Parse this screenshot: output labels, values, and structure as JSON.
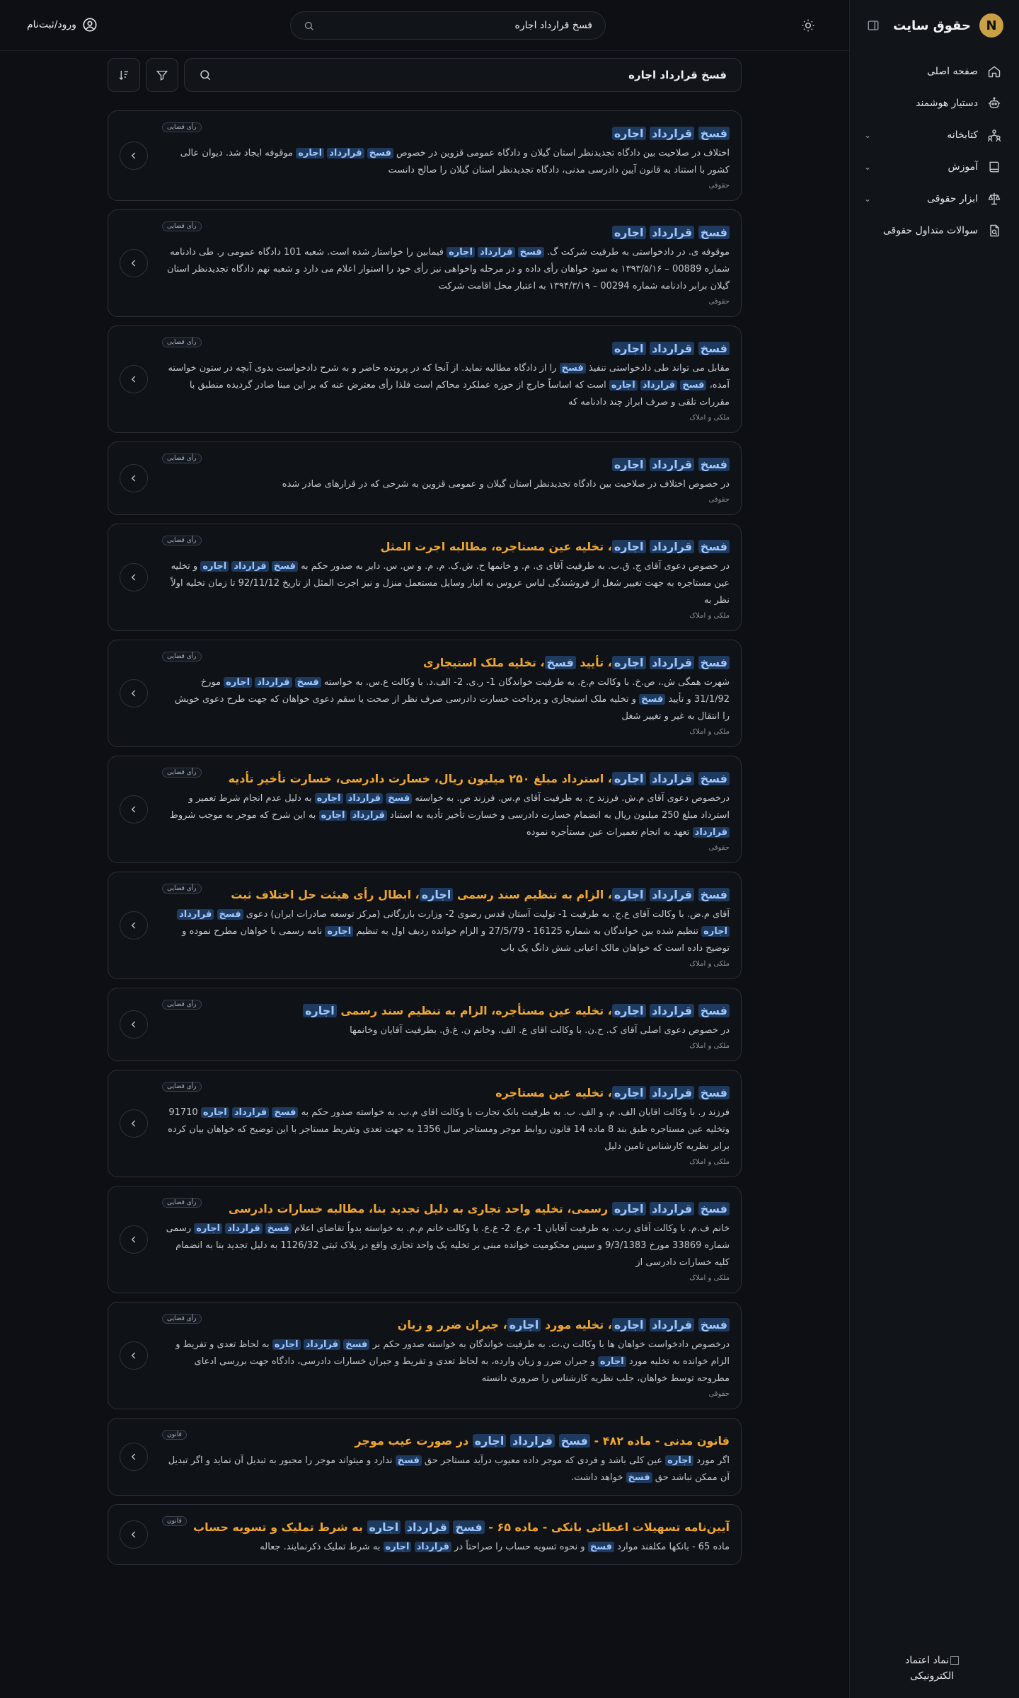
{
  "brand": {
    "logo_letter": "N",
    "name": "حقوق سایت",
    "accent": "#caa046"
  },
  "sidebar": {
    "items": [
      {
        "label": "صفحه اصلی",
        "icon": "home-icon",
        "expandable": false
      },
      {
        "label": "دستیار هوشمند",
        "icon": "robot-icon",
        "expandable": false
      },
      {
        "label": "کتابخانه",
        "icon": "library-icon",
        "expandable": true
      },
      {
        "label": "آموزش",
        "icon": "book-icon",
        "expandable": true
      },
      {
        "label": "ابزار حقوقی",
        "icon": "scale-icon",
        "expandable": true
      },
      {
        "label": "سوالات متداول حقوقی",
        "icon": "faq-document-icon",
        "expandable": false
      }
    ],
    "trust_logo_alt": "نماد اعتماد الکترونیکی"
  },
  "topbar": {
    "search_value": "فسخ قرارداد اجاره",
    "login_label": "ورود/ثبت‌نام"
  },
  "main": {
    "search_value": "فسخ قرارداد اجاره"
  },
  "colors": {
    "title": "#f0a62d",
    "highlight_bg": "#1e3a5f",
    "highlight_text": "#9fc7ff",
    "background": "#0d0f14"
  },
  "results": [
    {
      "badge": "رأی قضایی",
      "title": "<mark>فسخ</mark> <mark>قرارداد</mark> <mark>اجاره</mark>",
      "snippet": "اختلاف در صلاحیت بین دادگاه تجدیدنظر استان گیلان و دادگاه عمومی قزوین در خصوص <mark>فسخ</mark> <mark>قرارداد</mark> <mark>اجاره</mark> موقوفه ایجاد شد. دیوان عالی کشور با استناد به قانون آیین دادرسی مدنی، دادگاه تجدیدنظر استان گیلان را صالح دانست",
      "category": "حقوقی"
    },
    {
      "badge": "رأی قضایی",
      "title": "<mark>فسخ</mark> <mark>قرارداد</mark> <mark>اجاره</mark>",
      "snippet": "موقوفه ی. در دادخواستی به طرفیت شرکت گ. <mark>فسخ</mark> <mark>قرارداد</mark> <mark>اجاره</mark> فیمابین را خواستار شده است. شعبه 101 دادگاه عمومی ر. طی دادنامه شماره 00889 – ۱۳۹۳/۵/۱۶ به سود خواهان رأی داده و در مرحله واخواهی نیز رأی خود را استوار اعلام می دارد و شعبه نهم دادگاه تجدیدنظر استان گیلان برابر دادنامه شماره 00294 – ۱۳۹۴/۳/۱۹ به اعتبار محل اقامت شرکت",
      "category": "حقوقی"
    },
    {
      "badge": "رأی قضایی",
      "title": "<mark>فسخ</mark> <mark>قرارداد</mark> <mark>اجاره</mark>",
      "snippet": "مقابل می تواند طی دادخواستی تنفیذ <mark>فسخ</mark> را از دادگاه مطالبه نماید. از آنجا که در پرونده حاضر و به شرح دادخواست بدوی آنچه در ستون خواسته آمده، <mark>فسخ</mark> <mark>قرارداد</mark> <mark>اجاره</mark> است که اساساً خارج از حوزه عملکرد محاکم است فلذا رأی معترض عنه که بر این مبنا صادر گردیده منطبق با مقررات تلقی و صرف ابراز چند دادنامه که",
      "category": "ملکی و املاک"
    },
    {
      "badge": "رأی قضایی",
      "title": "<mark>فسخ</mark> <mark>قرارداد</mark> <mark>اجاره</mark>",
      "snippet": "در خصوص اختلاف در صلاحیت بین دادگاه تجدیدنظر استان گیلان و عمومی قزوین به شرحی که در قرارهای صادر شده",
      "category": "حقوقی"
    },
    {
      "badge": "رأی قضایی",
      "title": "<mark>فسخ</mark> <mark>قرارداد</mark> <mark>اجاره</mark>، تخلیه عین مستاجره، مطالبه اجرت المثل",
      "snippet": "در خصوص دعوی آقای ج. ق.ب. به طرفیت آقای ی. م. و خانمها ح. ش.ک. م. م. و س. س. دایر به صدور حکم به <mark>فسخ</mark> <mark>قرارداد</mark> <mark>اجاره</mark> و تخلیه عین مستاجره به جهت تغییر شغل از فروشندگی لباس عروس به انبار وسایل مستعمل منزل و نیز اجرت المثل از تاریخ 92/11/12 تا زمان تخلیه اولاً نظر به",
      "category": "ملکی و املاک"
    },
    {
      "badge": "رأی قضایی",
      "title": "<mark>فسخ</mark> <mark>قرارداد</mark> <mark>اجاره</mark>، تأیید <mark>فسخ</mark>، تخلیه ملک استیجاری",
      "snippet": "شهرت همگی ش.، ص.خ. با وکالت م.ع. به طرفیت خواندگان 1- ر.ی. 2- الف.د. با وکالت ع.س. به خواسته <mark>فسخ</mark> <mark>قرارداد</mark> <mark>اجاره</mark> مورخ 31/1/92 و تأیید <mark>فسخ</mark> و تخلیه ملک استیجاری و پرداخت خسارت دادرسی صرف نظر از صحت یا سقم دعوی خواهان که جهت طرح دعوی خویش را انتقال به غیر و تغییر شغل",
      "category": "ملکی و املاک"
    },
    {
      "badge": "رأی قضایی",
      "title": "<mark>فسخ</mark> <mark>قرارداد</mark> <mark>اجاره</mark>، استرداد مبلغ ۲۵۰ میلیون ریال، خسارت دادرسی، خسارت تأخیر تأدیه",
      "snippet": "درخصوص دعوی آقای م.ش. فرزند ح. به طرفیت آقای م.س. فرزند ص. به خواسته <mark>فسخ</mark> <mark>قرارداد</mark> <mark>اجاره</mark> به دلیل عدم انجام شرط تعمیر و استرداد مبلغ 250 میلیون ریال به انضمام خسارت دادرسی و خسارت تأخیر تأدیه به استناد <mark>قرارداد</mark> <mark>اجاره</mark> به این شرح که موجر به موجب شروط <mark>قرارداد</mark> تعهد به انجام تعمیرات عین مستأجره نموده",
      "category": "حقوقی"
    },
    {
      "badge": "رأی قضایی",
      "title": "<mark>فسخ</mark> <mark>قرارداد</mark> <mark>اجاره</mark>، الزام به تنظیم سند رسمی <mark>اجاره</mark>، ابطال رأی هیئت حل اختلاف ثبت",
      "snippet": "آقای م.ض. با وکالت آقای ع.ج. به طرفیت 1- تولیت آستان قدس رضوی 2- وزارت بازرگانی (مرکز توسعه صادرات ایران) دعوی <mark>فسخ</mark> <mark>قرارداد</mark> <mark>اجاره</mark> تنظیم شده بین خواندگان به شماره 16125 - 27/5/79 و الزام خوانده ردیف اول به تنظیم <mark>اجاره</mark> نامه رسمی با خواهان مطرح نموده و توضیح داده است که خواهان مالک اعیانی شش دانگ یک باب",
      "category": "ملکی و املاک"
    },
    {
      "badge": "رأی قضایی",
      "title": "<mark>فسخ</mark> <mark>قرارداد</mark> <mark>اجاره</mark>، تخلیه عین مستأجره، الزام به تنظیم سند رسمی <mark>اجاره</mark>",
      "snippet": "در خصوص دعوی اصلی آقای ک. ح.ن. با وکالت اقای ع. الف. وخانم ن. غ.ق. بطرفیت آقایان وخانمها",
      "category": "ملکی و املاک"
    },
    {
      "badge": "رأی قضایی",
      "title": "<mark>فسخ</mark> <mark>قرارداد</mark> <mark>اجاره</mark>، تخلیه عین مستاجره",
      "snippet": "فرزند ر. با وکالت اقایان الف. م. و الف. ب. به طرفیت بانک تجارت با وکالت اقای م.ب. به خواسته صدور حکم به <mark>فسخ</mark> <mark>قرارداد</mark> <mark>اجاره</mark> 91710 وتخلیه عین مستاجره طبق بند 8 ماده 14 قانون روابط موجر ومستاجر سال 1356 به جهت تعدی وتفریط مستاجر با این توضیح که خواهان بیان کرده برابر نظریه کارشناس تامین دلیل",
      "category": "ملکی و املاک"
    },
    {
      "badge": "رأی قضایی",
      "title": "<mark>فسخ</mark> <mark>قرارداد</mark> <mark>اجاره</mark> رسمی، تخلیه واحد تجاری به دلیل تجدید بنا، مطالبه خسارات دادرسی",
      "snippet": "خانم ف.م. با وکالت آقای ر.ب. به طرفیت آقایان 1- م.ع. 2- ع.ع. با وکالت خانم م.م. به خواسته بدواً تقاضای اعلام <mark>فسخ</mark> <mark>قرارداد</mark> <mark>اجاره</mark> رسمی شماره 33869 مورخ 9/3/1383 و سپس محکومیت خوانده مبنی بر تخلیه یک واحد تجاری واقع در پلاک ثبتی 1126/32 به دلیل تجدید بنا به انضمام کلیه خسارات دادرسی از",
      "category": "ملکی و املاک"
    },
    {
      "badge": "رأی قضایی",
      "title": "<mark>فسخ</mark> <mark>قرارداد</mark> <mark>اجاره</mark>، تخلیه مورد <mark>اجاره</mark>، جبران ضرر و زیان",
      "snippet": "درخصوص دادخواست خواهان ها با وکالت ن.ت. به طرفیت خواندگان به خواسته صدور حکم بر <mark>فسخ</mark> <mark>قرارداد</mark> <mark>اجاره</mark> به لحاظ تعدی و تفریط و الزام خوانده به تخلیه مورد <mark>اجاره</mark> و جبران ضرر و زیان وارده، به لحاظ تعدی و تفریط و جبران خسارات دادرسی، دادگاه جهت بررسی ادعای مطروحه توسط خواهان، جلب نظریه کارشناس را ضروری دانسته",
      "category": "حقوقی"
    },
    {
      "badge": "قانون",
      "title": "قانون مدنی - ماده ۴۸۲ - <mark>فسخ</mark> <mark>قرارداد</mark> <mark>اجاره</mark> در صورت عیب موجر",
      "snippet": "اگر مورد <mark>اجاره</mark> عین کلی باشد و فردی که موجر داده معیوب درآید مستاجر حق <mark>فسخ</mark> ندارد و میتواند موجر را مجبور به تبدیل آن نماید و اگر تبدیل آن ممکن نباشد حق <mark>فسخ</mark> خواهد داشت.",
      "category": ""
    },
    {
      "badge": "قانون",
      "title": "آیین‌نامه تسهیلات اعطائی بانکی - ماده ۶۵ - <mark>فسخ</mark> <mark>قرارداد</mark> <mark>اجاره</mark> به شرط تملیک و تسویه حساب",
      "snippet": "ماده 65 - بانکها مکلفند موارد <mark>فسخ</mark> و نحوه تسویه حساب را صراحتاً در <mark>قرارداد</mark> <mark>اجاره</mark> به شرط تملیک ذکرنمایند. جعاله",
      "category": ""
    }
  ]
}
